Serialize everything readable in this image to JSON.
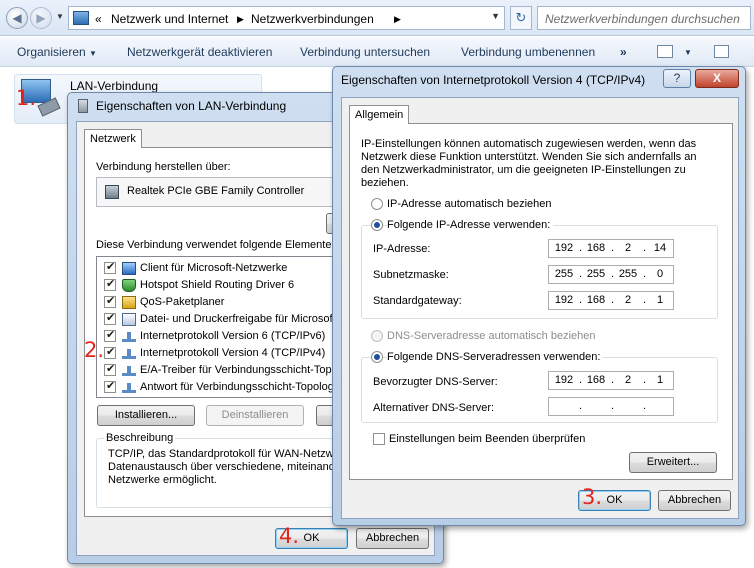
{
  "explorer": {
    "breadcrumb": [
      "«",
      "Netzwerk und Internet",
      "Netzwerkverbindungen"
    ],
    "search_placeholder": "Netzwerkverbindungen durchsuchen",
    "commands": [
      "Organisieren",
      "Netzwerkgerät deaktivieren",
      "Verbindung untersuchen",
      "Verbindung umbenennen",
      "»"
    ],
    "lan_item": "LAN-Verbindung"
  },
  "markers": [
    "1.",
    "2.",
    "3.",
    "4."
  ],
  "lan_dialog": {
    "title": "Eigenschaften von LAN-Verbindung",
    "tab": "Netzwerk",
    "connect_via_label": "Verbindung herstellen über:",
    "adapter": "Realtek PCIe GBE Family Controller",
    "elements_label": "Diese Verbindung verwendet folgende Elemente:",
    "components": [
      {
        "label": "Client für Microsoft-Netzwerke",
        "checked": true,
        "icon": "network-client-icon"
      },
      {
        "label": "Hotspot Shield Routing Driver 6",
        "checked": true,
        "icon": "shield-driver-icon"
      },
      {
        "label": "QoS-Paketplaner",
        "checked": true,
        "icon": "qos-scheduler-icon"
      },
      {
        "label": "Datei- und Druckerfreigabe für Microsoft-",
        "checked": true,
        "icon": "file-printer-share-icon"
      },
      {
        "label": "Internetprotokoll Version 6 (TCP/IPv6)",
        "checked": true,
        "icon": "protocol-icon"
      },
      {
        "label": "Internetprotokoll Version 4 (TCP/IPv4)",
        "checked": true,
        "icon": "protocol-icon"
      },
      {
        "label": "E/A-Treiber für Verbindungsschicht-Topo",
        "checked": true,
        "icon": "protocol-icon"
      },
      {
        "label": "Antwort für Verbindungsschicht-Topologie",
        "checked": true,
        "icon": "protocol-icon"
      }
    ],
    "install_button": "Installieren...",
    "uninstall_button": "Deinstallieren",
    "description_title": "Beschreibung",
    "description_text": [
      "TCP/IP, das Standardprotokoll für WAN-Netzw",
      "Datenaustausch über verschiedene, miteinande",
      "Netzwerke ermöglicht."
    ],
    "ok_button": "OK",
    "cancel_button": "Abbrechen"
  },
  "ipv4_dialog": {
    "title": "Eigenschaften von Internetprotokoll Version 4 (TCP/IPv4)",
    "help_button": "?",
    "close_button": "X",
    "tab": "Allgemein",
    "intro_lines": [
      "IP-Einstellungen können automatisch zugewiesen werden, wenn das",
      "Netzwerk diese Funktion unterstützt. Wenden Sie sich andernfalls an",
      "den Netzwerkadministrator, um die geeigneten IP-Einstellungen zu",
      "beziehen."
    ],
    "ip_auto": "IP-Adresse automatisch beziehen",
    "ip_manual": "Folgende IP-Adresse verwenden:",
    "ip_label": "IP-Adresse:",
    "ip_value": [
      "192",
      "168",
      "2",
      "14"
    ],
    "subnet_label": "Subnetzmaske:",
    "subnet_value": [
      "255",
      "255",
      "255",
      "0"
    ],
    "gateway_label": "Standardgateway:",
    "gateway_value": [
      "192",
      "168",
      "2",
      "1"
    ],
    "dns_auto": "DNS-Serveradresse automatisch beziehen",
    "dns_manual": "Folgende DNS-Serveradressen verwenden:",
    "dns_pref_label": "Bevorzugter DNS-Server:",
    "dns_pref_value": [
      "192",
      "168",
      "2",
      "1"
    ],
    "dns_alt_label": "Alternativer DNS-Server:",
    "validate_label": "Einstellungen beim Beenden überprüfen",
    "advanced_button": "Erweitert...",
    "ok_button": "OK",
    "cancel_button": "Abbrechen"
  }
}
